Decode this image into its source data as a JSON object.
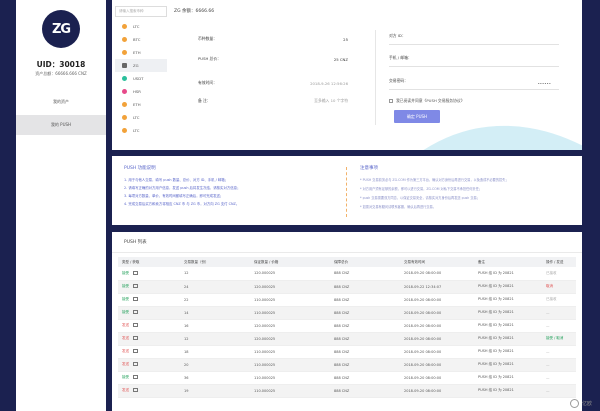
{
  "sidebar": {
    "logo_text": "ZG",
    "uid": "UID：30018",
    "asset": "资产总额：66666.666 CNZ",
    "items": [
      {
        "label": "我的资产"
      },
      {
        "label": "我的 PUSH"
      }
    ]
  },
  "top": {
    "search_placeholder": "请输入搜索币种",
    "balance": "ZG 余额：6666.66",
    "coins": [
      "LTC",
      "BTC",
      "ETH",
      "ZG",
      "USDT",
      "HSR",
      "ETH",
      "LTC",
      "LTC"
    ],
    "form": {
      "amount_label": "币种数量：",
      "amount_value": "25",
      "push_price_label": "PUSH 总价：",
      "push_price_value": "25  CNZ",
      "valid_label": "有效时间：",
      "valid_value": "2018-9-26 12:56:26",
      "note_label": "备      注：",
      "note_value": "至多输入 10 个字符"
    },
    "right": {
      "uid_label": "对方 ID：",
      "phone_label": "手机 / 邮箱：",
      "pwd_label": "交易密码：",
      "pwd_value": "••••••",
      "checkbox_label": "我已阅读并同意《PUSH 交易服务协议》",
      "push_button": "确定 PUSH"
    }
  },
  "intro": {
    "title": "PUSH 功能说明",
    "lines": [
      "1. 用于与他人交易，填写 push 数量、总价、对方 ID、手机 / 邮箱；",
      "2. 请填写正确的对方用户信息，发送 push 后将发生冻结，请核实对方信息；",
      "3. 每项对方数量、单价、有效时间都填写正确后，即可完成发送；",
      "4. 完成交易后买方和卖方将相应 CNZ 币 与 ZG 币，对方向 ZG 支付 CNZ。"
    ]
  },
  "notice": {
    "title": "注意事项",
    "lines": [
      "* PUSH 交易前务必与 ZG.COM 作为第三方平台，确认对方身份后再进行交易，以免造成不必要的损失；",
      "* 对方用户须有足够的余额，即可以进行交易，ZG.COM 对私下交易不承担任何责任；",
      "* push 交易需要双方同意，以保证交易安全，请核实对方身份后再发送 push 交易；",
      "* 如需对交易有疑问请联系客服，确认后再进行交易。"
    ]
  },
  "table": {
    "title": "PUSH 列表",
    "headers": [
      "类型 / 获取",
      "交易数量（份）",
      "保证数量 / 价格",
      "保障总价",
      "交易有效时间",
      "备注",
      "操作 / 发送"
    ],
    "rows": [
      {
        "type": "接受",
        "qty": "12",
        "price": "120.000025",
        "total": "888 CNZ",
        "time": "2018-09-20 08:00:00",
        "note": "PUSH 给 ID 为 20821",
        "op": "已接收",
        "op_class": "op-muted",
        "type_class": "st-ok"
      },
      {
        "type": "接受",
        "qty": "24",
        "price": "120.000025",
        "total": "888 CNZ",
        "time": "2018-09-22 12:34:07",
        "note": "PUSH 给 ID 为 20821",
        "op": "取消",
        "op_class": "op-red",
        "type_class": "st-ok"
      },
      {
        "type": "接受",
        "qty": "22",
        "price": "110.000025",
        "total": "888 CNZ",
        "time": "2018-09-20 08:00:00",
        "note": "PUSH 给 ID 为 20821",
        "op": "已接收",
        "op_class": "op-muted",
        "type_class": "st-ok"
      },
      {
        "type": "接受",
        "qty": "14",
        "price": "110.000025",
        "total": "888 CNZ",
        "time": "2018-09-20 08:00:00",
        "note": "PUSH 给 ID 为 20821",
        "op": "—",
        "op_class": "op-muted",
        "type_class": "st-ok"
      },
      {
        "type": "发送",
        "qty": "16",
        "price": "120.000025",
        "total": "888 CNZ",
        "time": "2018-09-20 08:00:00",
        "note": "PUSH 给 ID 为 20821",
        "op": "—",
        "op_class": "op-muted",
        "type_class": "st-warn"
      },
      {
        "type": "发送",
        "qty": "12",
        "price": "120.000025",
        "total": "888 CNZ",
        "time": "2018-09-20 08:00:00",
        "note": "PUSH 给 ID 为 20821",
        "op": "接受 / 取消",
        "op_class": "op-green",
        "type_class": "st-warn"
      },
      {
        "type": "发送",
        "qty": "18",
        "price": "110.000025",
        "total": "888 CNZ",
        "time": "2018-09-20 08:00:00",
        "note": "PUSH 给 ID 为 20821",
        "op": "—",
        "op_class": "op-muted",
        "type_class": "st-warn"
      },
      {
        "type": "发送",
        "qty": "20",
        "price": "110.000025",
        "total": "888 CNZ",
        "time": "2018-09-20 08:00:00",
        "note": "PUSH 给 ID 为 20821",
        "op": "—",
        "op_class": "op-muted",
        "type_class": "st-warn"
      },
      {
        "type": "接受",
        "qty": "36",
        "price": "110.000025",
        "total": "888 CNZ",
        "time": "2018-09-20 08:00:00",
        "note": "PUSH 给 ID 为 20821",
        "op": "—",
        "op_class": "op-muted",
        "type_class": "st-ok"
      },
      {
        "type": "发送",
        "qty": "19",
        "price": "110.000025",
        "total": "888 CNZ",
        "time": "2018-09-20 08:00:00",
        "note": "PUSH 给 ID 为 20821",
        "op": "—",
        "op_class": "op-muted",
        "type_class": "st-warn"
      }
    ]
  },
  "watermark": {
    "text": "亿欧"
  },
  "colors": {
    "background": "#1b2150",
    "accent": "#7f89e6",
    "success": "#22a05a",
    "danger": "#e05050"
  }
}
